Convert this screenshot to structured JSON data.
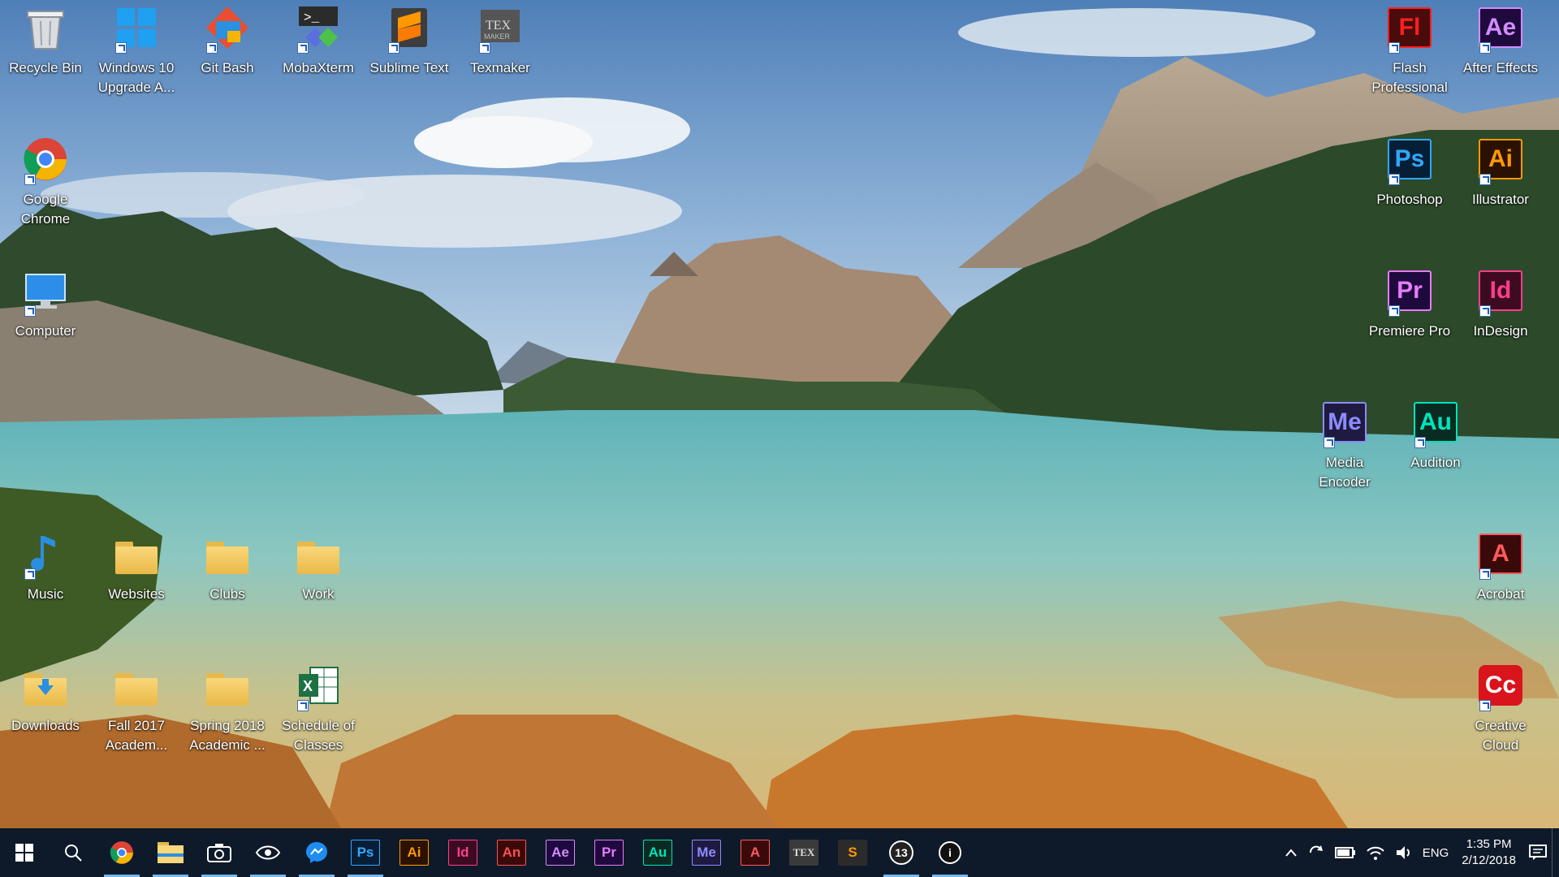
{
  "desktop": {
    "icons_left": [
      {
        "id": "recycle-bin",
        "label": "Recycle Bin"
      },
      {
        "id": "windows10-upgrade",
        "label": "Windows 10 Upgrade A..."
      },
      {
        "id": "git-bash",
        "label": "Git Bash"
      },
      {
        "id": "mobaxterm",
        "label": "MobaXterm"
      },
      {
        "id": "sublime-text",
        "label": "Sublime Text"
      },
      {
        "id": "texmaker",
        "label": "Texmaker"
      },
      {
        "id": "google-chrome",
        "label": "Google Chrome"
      },
      {
        "id": "computer",
        "label": "Computer"
      },
      {
        "id": "music",
        "label": "Music"
      },
      {
        "id": "websites",
        "label": "Websites"
      },
      {
        "id": "clubs",
        "label": "Clubs"
      },
      {
        "id": "work",
        "label": "Work"
      },
      {
        "id": "downloads",
        "label": "Downloads"
      },
      {
        "id": "fall-2017",
        "label": "Fall 2017 Academ..."
      },
      {
        "id": "spring-2018",
        "label": "Spring 2018 Academic ..."
      },
      {
        "id": "schedule-of-classes",
        "label": "Schedule of Classes"
      }
    ],
    "icons_right": [
      {
        "id": "flash",
        "label": "Flash Professional",
        "abbr": "Fl",
        "bg": "#4a0b0b",
        "fg": "#ff1f1f"
      },
      {
        "id": "after-effects",
        "label": "After Effects",
        "abbr": "Ae",
        "bg": "#1f0a3d",
        "fg": "#d38cff"
      },
      {
        "id": "photoshop",
        "label": "Photoshop",
        "abbr": "Ps",
        "bg": "#071f36",
        "fg": "#31a8ff"
      },
      {
        "id": "illustrator",
        "label": "Illustrator",
        "abbr": "Ai",
        "bg": "#2b1100",
        "fg": "#ff9a00"
      },
      {
        "id": "premiere-pro",
        "label": "Premiere Pro",
        "abbr": "Pr",
        "bg": "#1f0a3d",
        "fg": "#e77bff"
      },
      {
        "id": "indesign",
        "label": "InDesign",
        "abbr": "Id",
        "bg": "#3d0b21",
        "fg": "#ff3d8b"
      },
      {
        "id": "media-encoder",
        "label": "Media Encoder",
        "abbr": "Me",
        "bg": "#1f1a40",
        "fg": "#8c8cff"
      },
      {
        "id": "audition",
        "label": "Audition",
        "abbr": "Au",
        "bg": "#0a2b22",
        "fg": "#00e4bb"
      },
      {
        "id": "acrobat",
        "label": "Acrobat",
        "abbr": "A",
        "bg": "#3a0a0a",
        "fg": "#ff5a5a"
      },
      {
        "id": "creative-cloud",
        "label": "Creative Cloud",
        "abbr": "Cc",
        "bg": "#d9141c",
        "fg": "#ffffff"
      }
    ],
    "texmaker_badge": "TEX",
    "maker_badge": "MAKER"
  },
  "taskbar": {
    "apps": [
      {
        "id": "search",
        "label": ""
      },
      {
        "id": "chrome",
        "label": ""
      },
      {
        "id": "explorer",
        "label": ""
      },
      {
        "id": "camera",
        "label": ""
      },
      {
        "id": "mobaxterm",
        "label": ""
      },
      {
        "id": "messenger",
        "label": ""
      },
      {
        "id": "photoshop",
        "label": "Ps",
        "bg": "#071f36",
        "fg": "#31a8ff"
      },
      {
        "id": "illustrator",
        "label": "Ai",
        "bg": "#2b1100",
        "fg": "#ff9a00"
      },
      {
        "id": "indesign",
        "label": "Id",
        "bg": "#3d0b21",
        "fg": "#ff3d8b"
      },
      {
        "id": "animate",
        "label": "An",
        "bg": "#3a0a0a",
        "fg": "#ff4f4f"
      },
      {
        "id": "after-effects",
        "label": "Ae",
        "bg": "#1f0a3d",
        "fg": "#d38cff"
      },
      {
        "id": "premiere",
        "label": "Pr",
        "bg": "#1f0a3d",
        "fg": "#e77bff"
      },
      {
        "id": "audition",
        "label": "Au",
        "bg": "#0a2b22",
        "fg": "#00e4bb"
      },
      {
        "id": "media-encoder",
        "label": "Me",
        "bg": "#1f1a40",
        "fg": "#8c8cff"
      },
      {
        "id": "acrobat",
        "label": "A",
        "bg": "#3a0a0a",
        "fg": "#ff5a5a"
      },
      {
        "id": "texmaker",
        "label": "TEX",
        "bg": "#3a3a3a",
        "fg": "#dddddd"
      },
      {
        "id": "sublime",
        "label": "S",
        "bg": "#2b2b2b",
        "fg": "#ff9800"
      },
      {
        "id": "badge-13",
        "label": "13",
        "bg": "#222",
        "fg": "#ffffff"
      },
      {
        "id": "info",
        "label": "i",
        "bg": "#111",
        "fg": "#ffffff"
      }
    ],
    "tray": {
      "language": "ENG",
      "time": "1:35 PM",
      "date": "2/12/2018"
    }
  }
}
